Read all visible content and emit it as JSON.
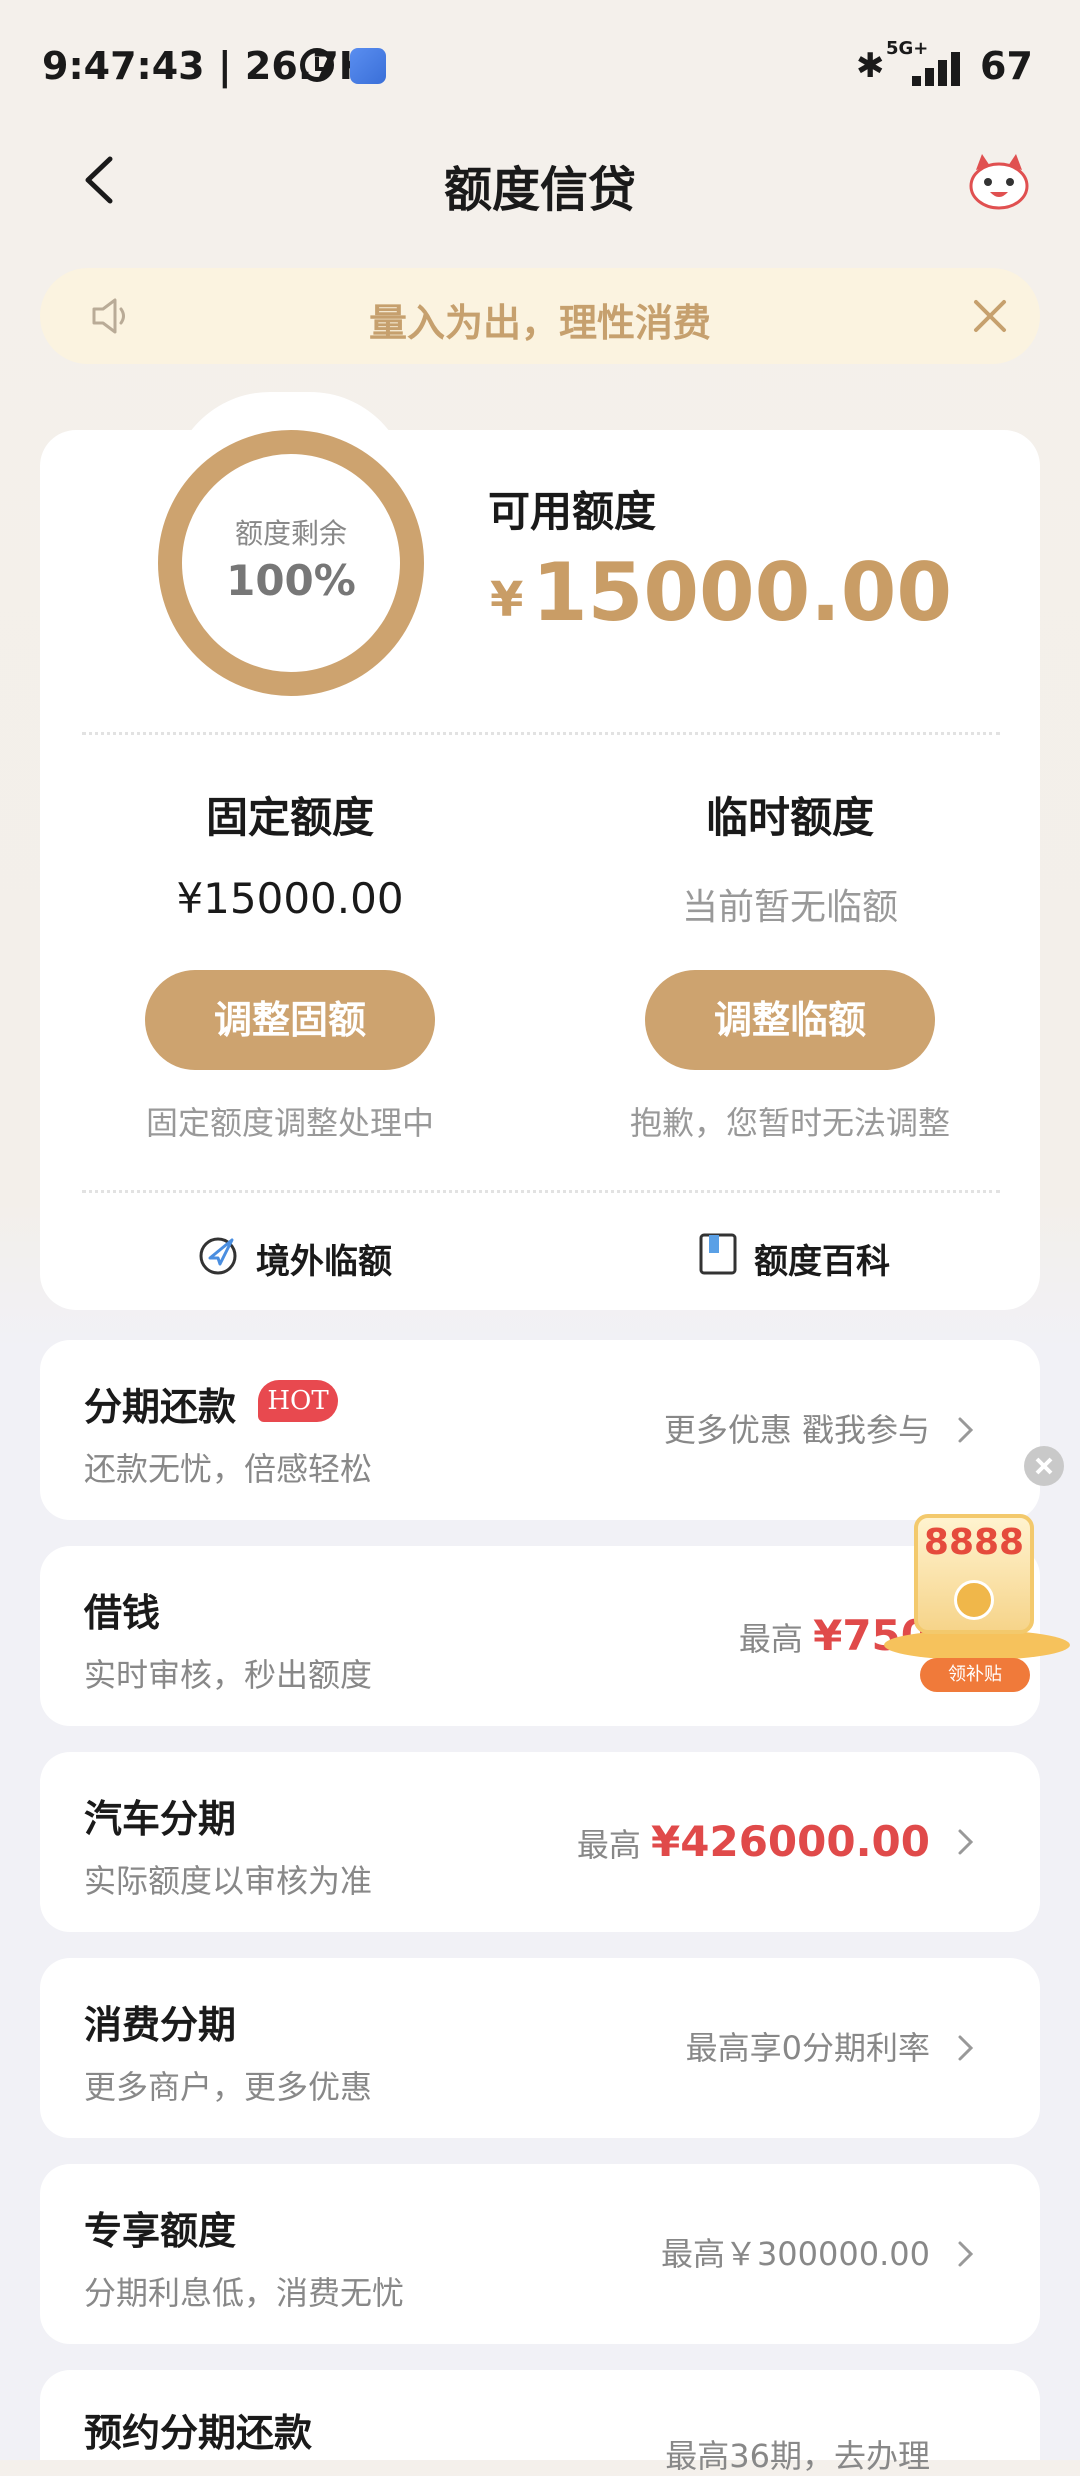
{
  "status_bar": {
    "time_speed": "9:47:43 | 26.7K",
    "bluetooth": "✱",
    "network": "5G+",
    "battery": "67"
  },
  "header": {
    "title": "额度信贷"
  },
  "notice": {
    "text": "量入为出，理性消费"
  },
  "quota": {
    "ring_label": "额度剩余",
    "ring_percent": "100%",
    "ring_fraction": 1.0,
    "available_label": "可用额度",
    "currency": "¥",
    "available_value": "15000.00",
    "fixed": {
      "title": "固定额度",
      "amount": "¥15000.00",
      "button": "调整固额",
      "note": "固定额度调整处理中"
    },
    "temporary": {
      "title": "临时额度",
      "amount": "当前暂无临额",
      "button": "调整临额",
      "note": "抱歉，您暂时无法调整"
    },
    "links": {
      "overseas": "境外临额",
      "encyclopedia": "额度百科"
    }
  },
  "list": {
    "installment": {
      "title": "分期还款",
      "badge": "HOT",
      "subtitle": "还款无忧，倍感轻松",
      "right": "更多优惠 戳我参与"
    },
    "borrow": {
      "title": "借钱",
      "subtitle": "实时审核，秒出额度",
      "prefix": "最高",
      "amount": "¥750"
    },
    "car": {
      "title": "汽车分期",
      "subtitle": "实际额度以审核为准",
      "prefix": "最高",
      "amount": "¥426000.00"
    },
    "consume": {
      "title": "消费分期",
      "subtitle": "更多商户，更多优惠",
      "right": "最高享0分期利率"
    },
    "exclusive": {
      "title": "专享额度",
      "subtitle": "分期利息低，消费无忧",
      "right": "最高￥300000.00"
    },
    "reserve": {
      "title": "预约分期还款",
      "right": "最高36期，去办理"
    }
  },
  "promo": {
    "amount": "8888",
    "pill": "领补贴"
  },
  "colors": {
    "accent_gold": "#cda36f",
    "amount_red": "#e04a4a",
    "notice_bg": "#fbf3e0"
  }
}
